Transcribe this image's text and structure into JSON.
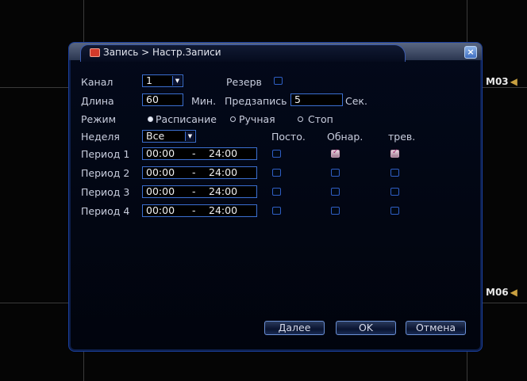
{
  "background": {
    "camera_labels": [
      {
        "id": "M03",
        "label": "M03"
      },
      {
        "id": "M06",
        "label": "M06"
      }
    ]
  },
  "dialog": {
    "title": "Запись > Настр.Записи",
    "close_glyph": "×"
  },
  "form": {
    "channel_label": "Канал",
    "channel_value": "1",
    "reserve_label": "Резерв",
    "reserve_checked": false,
    "length_label": "Длина",
    "length_value": "60",
    "length_unit": "Мин.",
    "prerecord_label": "Предзапись",
    "prerecord_value": "5",
    "prerecord_unit": "Сек.",
    "mode_label": "Режим",
    "modes": [
      {
        "label": "Расписание",
        "selected": true
      },
      {
        "label": "Ручная",
        "selected": false
      },
      {
        "label": "Стоп",
        "selected": false
      }
    ],
    "week_label": "Неделя",
    "week_value": "Все",
    "col_headers": {
      "constant": "Посто.",
      "detect": "Обнар.",
      "alarm": "трев."
    },
    "periods": [
      {
        "label": "Период 1",
        "start": "00:00",
        "end": "24:00",
        "constant": false,
        "detect": true,
        "alarm": true
      },
      {
        "label": "Период 2",
        "start": "00:00",
        "end": "24:00",
        "constant": false,
        "detect": false,
        "alarm": false
      },
      {
        "label": "Период 3",
        "start": "00:00",
        "end": "24:00",
        "constant": false,
        "detect": false,
        "alarm": false
      },
      {
        "label": "Период 4",
        "start": "00:00",
        "end": "24:00",
        "constant": false,
        "detect": false,
        "alarm": false
      }
    ],
    "period_separator": "-"
  },
  "buttons": {
    "next": "Далее",
    "ok": "OK",
    "cancel": "Отмена"
  },
  "colors": {
    "field_border": "#3b6fd0",
    "dialog_bg": "#03091a",
    "checked": "#c8a0b8"
  }
}
